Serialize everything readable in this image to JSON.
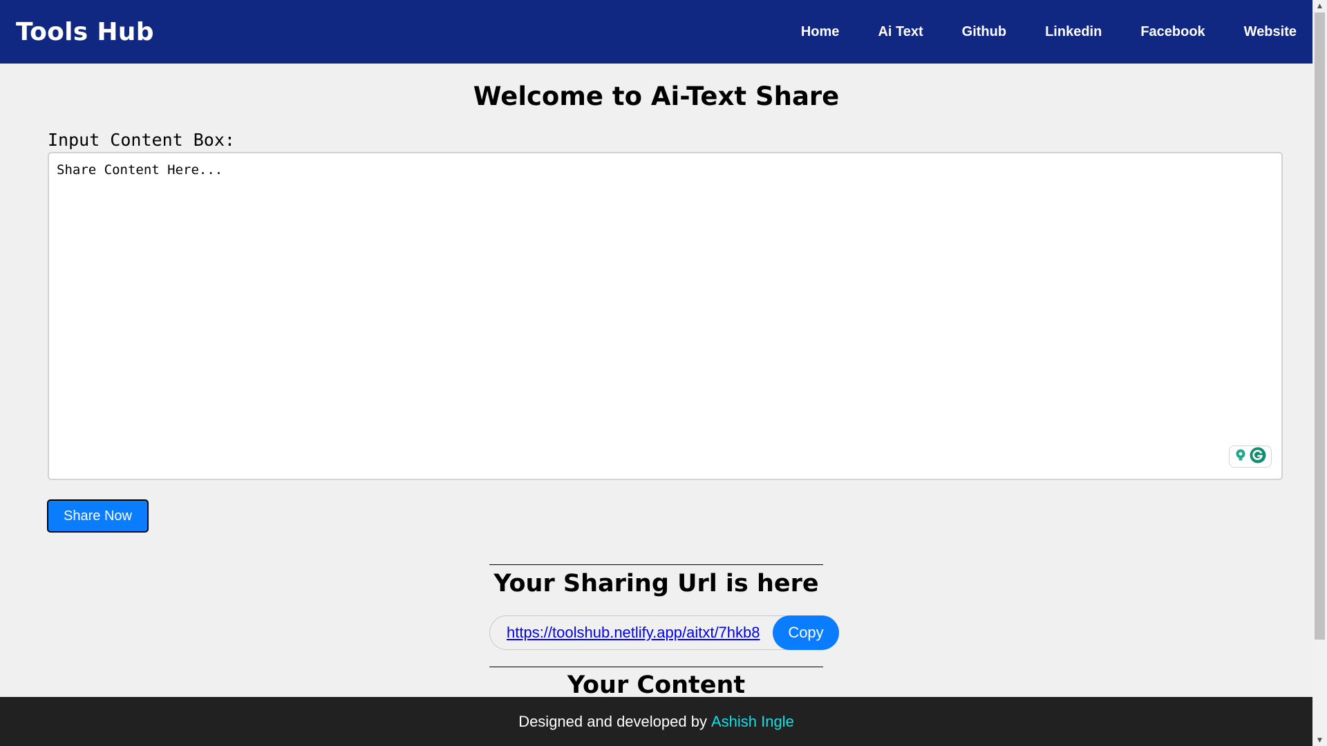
{
  "header": {
    "brand": "Tools Hub",
    "nav": [
      "Home",
      "Ai Text",
      "Github",
      "Linkedin",
      "Facebook",
      "Website"
    ]
  },
  "main": {
    "title": "Welcome to Ai-Text Share",
    "input_label": "Input Content Box:",
    "textarea_placeholder": "Share Content Here...",
    "share_button": "Share Now",
    "sharing_url_title": "Your Sharing Url is here",
    "sharing_url": "https://toolshub.netlify.app/aitxt/7hkb8",
    "copy_button": "Copy",
    "content_title": "Your Content"
  },
  "footer": {
    "text": "Designed and developed by",
    "author": "Ashish Ingle"
  },
  "colors": {
    "header_bg": "#112882",
    "accent_blue": "#0a7dff",
    "footer_bg": "#212121",
    "author_link": "#12e0e6"
  },
  "icons": {
    "grammarly_bulb": "lightbulb-icon",
    "grammarly_logo": "grammarly-icon"
  }
}
